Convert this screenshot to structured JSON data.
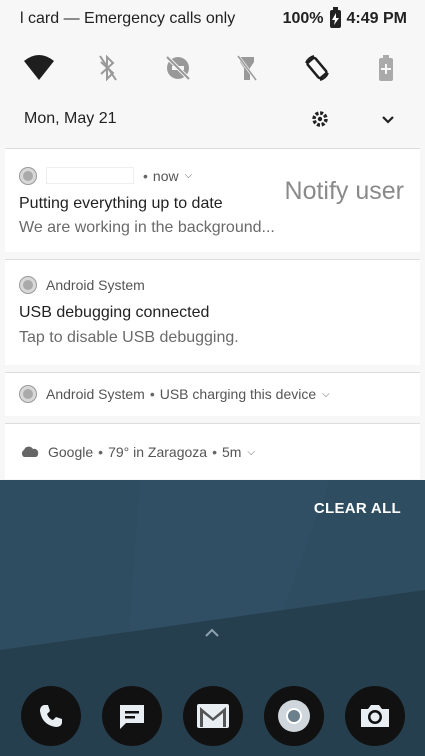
{
  "status_bar": {
    "carrier_text": "l card — Emergency calls only",
    "battery_percent": "100%",
    "time": "4:49 PM"
  },
  "quick_settings": {
    "tiles": [
      "wifi-icon",
      "bluetooth-off-icon",
      "dnd-off-icon",
      "flashlight-off-icon",
      "auto-rotate-icon",
      "battery-saver-icon"
    ]
  },
  "header": {
    "date": "Mon, May 21"
  },
  "notifications": [
    {
      "app": "",
      "time": "now",
      "title": "Putting everything up to date",
      "text": "We are working in the background...",
      "extra": "Notify user"
    },
    {
      "app": "Android System",
      "title": "USB debugging connected",
      "text": "Tap to disable USB debugging."
    },
    {
      "app": "Android System",
      "summary": "USB charging this device"
    },
    {
      "app": "Google",
      "weather": "79° in Zaragoza",
      "time": "5m"
    }
  ],
  "clear_all_label": "CLEAR ALL",
  "dock": {
    "apps": [
      "phone-icon",
      "messages-icon",
      "gmail-icon",
      "chrome-icon",
      "camera-icon"
    ]
  },
  "colors": {
    "shade_bg": "#f7f7f7",
    "wallpaper": "#2a4556"
  }
}
